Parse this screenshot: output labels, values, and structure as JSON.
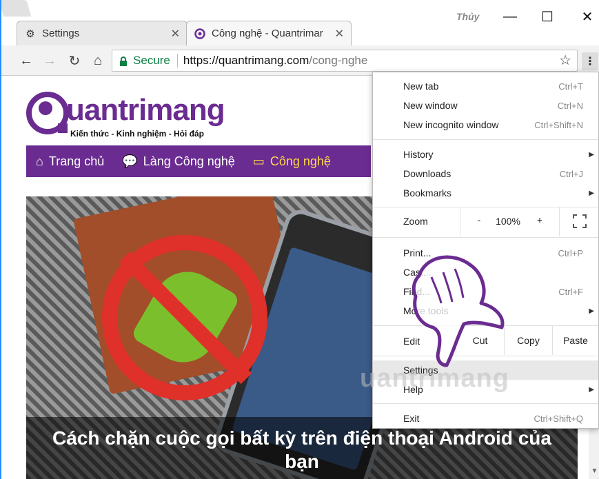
{
  "browser": {
    "tabs": [
      {
        "title": "Settings",
        "icon": "gear-icon"
      },
      {
        "title": "Công nghệ - Quantrimar",
        "icon": "site-favicon"
      }
    ],
    "user_name": "Thủy",
    "address": {
      "secure_label": "Secure",
      "url_host": "https://quantrimang.com",
      "url_path": "/cong-nghe"
    }
  },
  "site": {
    "logo_text": "uantrimang",
    "tagline": "Kiến thức - Kinh nghiệm - Hỏi đáp",
    "nav": [
      {
        "label": "Trang chủ",
        "icon": "home-icon"
      },
      {
        "label": "Làng Công nghệ",
        "icon": "chat-icon"
      },
      {
        "label": "Công nghệ",
        "icon": "laptop-icon"
      }
    ],
    "article_title": "Cách chặn cuộc gọi bất kỳ trên điện thoại Android của bạn",
    "watermark": "uantrimang"
  },
  "menu": {
    "new_tab": {
      "label": "New tab",
      "shortcut": "Ctrl+T"
    },
    "new_window": {
      "label": "New window",
      "shortcut": "Ctrl+N"
    },
    "new_incognito": {
      "label": "New incognito window",
      "shortcut": "Ctrl+Shift+N"
    },
    "history": {
      "label": "History"
    },
    "downloads": {
      "label": "Downloads",
      "shortcut": "Ctrl+J"
    },
    "bookmarks": {
      "label": "Bookmarks"
    },
    "zoom": {
      "label": "Zoom",
      "minus": "-",
      "value": "100%",
      "plus": "+"
    },
    "print": {
      "label": "Print...",
      "shortcut": "Ctrl+P"
    },
    "cast": {
      "label": "Cast..."
    },
    "find": {
      "label": "Find...",
      "shortcut": "Ctrl+F"
    },
    "more_tools": {
      "label": "More tools"
    },
    "edit": {
      "label": "Edit",
      "cut": "Cut",
      "copy": "Copy",
      "paste": "Paste"
    },
    "settings": {
      "label": "Settings"
    },
    "help": {
      "label": "Help"
    },
    "exit": {
      "label": "Exit",
      "shortcut": "Ctrl+Shift+Q"
    }
  }
}
